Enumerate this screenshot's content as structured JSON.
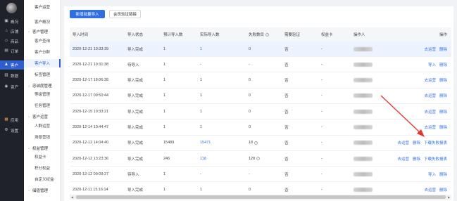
{
  "nav": {
    "items": [
      {
        "label": "概况",
        "icon": "overview-icon"
      },
      {
        "label": "店铺",
        "icon": "store-icon"
      },
      {
        "label": "商品",
        "icon": "goods-icon"
      },
      {
        "label": "订单",
        "icon": "order-icon"
      },
      {
        "label": "客户",
        "icon": "customer-icon"
      },
      {
        "label": "数据",
        "icon": "data-icon"
      },
      {
        "label": "资产",
        "icon": "assets-icon"
      },
      {
        "label": "应用",
        "icon": "apps-icon"
      },
      {
        "label": "设置",
        "icon": "settings-icon"
      }
    ],
    "active_index": 4
  },
  "submenu": {
    "title": "客户运营",
    "overview": "客户概况",
    "groups": [
      {
        "label": "客户管理",
        "children": [
          "客户查询",
          "客户分群",
          "客户导入",
          "标签管理"
        ]
      },
      {
        "label": "忠诚度管理",
        "children": [
          "等级管理",
          "任务管理"
        ]
      },
      {
        "label": "客户运营",
        "children": [
          "人群运营",
          "场景营销"
        ]
      },
      {
        "label": "权益管理",
        "children": [
          "权益卡",
          "积分权益",
          "自定义权益"
        ]
      },
      {
        "label": "储值管理",
        "children": []
      }
    ],
    "active": "客户导入"
  },
  "toolbar": {
    "primary_label": "新增批量导入",
    "secondary_label": "会员验证链接"
  },
  "table": {
    "columns": [
      "导入时间",
      "导入状态",
      "预计导入数",
      "实际导入数",
      "失败数目",
      "需要验证",
      "权益卡",
      "操作人",
      "操作"
    ],
    "rows": [
      {
        "time": "2020-12-21 10:33:39",
        "status": "导入完成",
        "est": "1",
        "actual": "1",
        "actual_link": true,
        "fail": "0",
        "verify": "否",
        "rights": "-",
        "actions": [
          "去运营",
          "删除"
        ]
      },
      {
        "time": "2020-12-21 10:31:38",
        "status": "待导入",
        "est": "1",
        "actual": "-",
        "actual_link": false,
        "fail": "-",
        "verify": "否",
        "rights": "-",
        "actions": [
          "导入",
          "删除"
        ]
      },
      {
        "time": "2020-12-17 18:06:28",
        "status": "导入完成",
        "est": "1",
        "actual": "1",
        "actual_link": false,
        "fail": "0",
        "verify": "否",
        "rights": "-",
        "actions": [
          "去运营",
          "删除"
        ]
      },
      {
        "time": "2020-12-17 09:50:44",
        "status": "导入完成",
        "est": "1",
        "actual": "1",
        "actual_link": false,
        "fail": "0",
        "verify": "否",
        "rights": "-",
        "actions": [
          "去运营",
          "删除"
        ]
      },
      {
        "time": "2020-12-15 10:33:21",
        "status": "导入完成",
        "est": "1",
        "actual": "1",
        "actual_link": false,
        "fail": "0",
        "verify": "否",
        "rights": "-",
        "actions": [
          "去运营",
          "删除"
        ]
      },
      {
        "time": "2020-12-14 10:44:47",
        "status": "导入完成",
        "est": "1",
        "actual": "1",
        "actual_link": false,
        "fail": "0",
        "verify": "否",
        "rights": "-",
        "actions": [
          "去运营",
          "删除"
        ]
      },
      {
        "time": "2020-12-12 14:04:40",
        "status": "导入完成",
        "est": "15489",
        "actual": "15471",
        "actual_link": true,
        "fail": "18",
        "fail_help": true,
        "verify": "否",
        "rights": "-",
        "actions": [
          "去运营",
          "删除",
          "下载失败报表"
        ]
      },
      {
        "time": "2020-12-12 13:23:36",
        "status": "导入完成",
        "est": "246",
        "actual": "118",
        "actual_link": true,
        "fail": "128",
        "fail_help": true,
        "verify": "否",
        "rights": "-",
        "actions": [
          "去运营",
          "删除",
          "下载失败报表"
        ]
      },
      {
        "time": "2020-12-12 09:09:27",
        "status": "待导入",
        "est": "1",
        "actual": "-",
        "actual_link": false,
        "fail": "-",
        "verify": "否",
        "rights": "-",
        "actions": [
          "导入",
          "删除"
        ]
      },
      {
        "time": "2020-12-11 15:16:14",
        "status": "导入完成",
        "est": "1",
        "actual": "1",
        "actual_link": false,
        "fail": "0",
        "verify": "否",
        "rights": "-",
        "actions": [
          "去运营",
          "删除"
        ]
      }
    ]
  },
  "colors": {
    "primary": "#2f6fe0",
    "nav_bg": "#1f2229",
    "annotation": "#e8322d"
  }
}
